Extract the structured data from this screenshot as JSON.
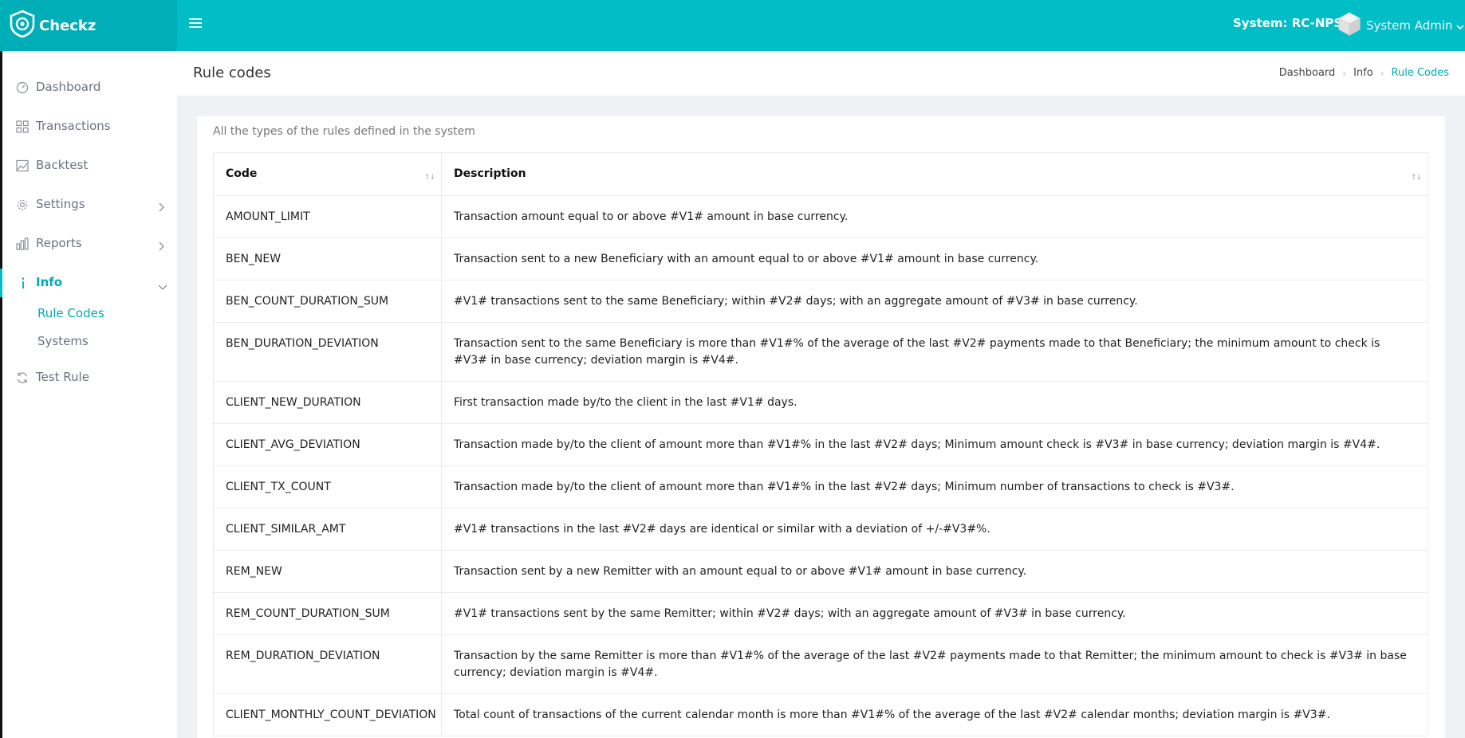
{
  "app": {
    "name": "Checkz",
    "system_label": "System: RC-NPS",
    "user": "System Admin"
  },
  "sidebar": {
    "items": [
      {
        "label": "Dashboard",
        "icon": "dashboard-gauge-icon"
      },
      {
        "label": "Transactions",
        "icon": "grid-icon"
      },
      {
        "label": "Backtest",
        "icon": "image-chart-icon"
      },
      {
        "label": "Settings",
        "icon": "gear-icon"
      },
      {
        "label": "Reports",
        "icon": "bar-chart-icon"
      },
      {
        "label": "Info",
        "icon": "info-icon"
      },
      {
        "label": "Test Rule",
        "icon": "refresh-icon"
      }
    ],
    "info_sub": [
      {
        "label": "Rule Codes"
      },
      {
        "label": "Systems"
      }
    ]
  },
  "page": {
    "title": "Rule codes",
    "breadcrumb": [
      "Dashboard",
      "Info",
      "Rule Codes"
    ],
    "description": "All the types of the rules defined in the system"
  },
  "table": {
    "headers": [
      "Code",
      "Description"
    ],
    "sort_glyph": "↑↓",
    "rows": [
      {
        "code": "AMOUNT_LIMIT",
        "desc": "Transaction amount equal to or above #V1# amount in base currency."
      },
      {
        "code": "BEN_NEW",
        "desc": "Transaction sent to a new Beneficiary with an amount equal to or above #V1# amount in base currency."
      },
      {
        "code": "BEN_COUNT_DURATION_SUM",
        "desc": "#V1# transactions sent to the same Beneficiary; within #V2# days; with an aggregate amount of #V3# in base currency."
      },
      {
        "code": "BEN_DURATION_DEVIATION",
        "desc": "Transaction sent to the same Beneficiary is more than #V1#% of the average of the last #V2# payments made to that Beneficiary; the minimum amount to check is #V3# in base currency; deviation margin is #V4#."
      },
      {
        "code": "CLIENT_NEW_DURATION",
        "desc": "First transaction made by/to the client in the last #V1# days."
      },
      {
        "code": "CLIENT_AVG_DEVIATION",
        "desc": "Transaction made by/to the client of amount more than #V1#% in the last #V2# days; Minimum amount check is #V3# in base currency; deviation margin is #V4#."
      },
      {
        "code": "CLIENT_TX_COUNT",
        "desc": "Transaction made by/to the client of amount more than #V1#% in the last #V2# days; Minimum number of transactions to check is #V3#."
      },
      {
        "code": "CLIENT_SIMILAR_AMT",
        "desc": "#V1# transactions in the last #V2# days are identical or similar with a deviation of +/-#V3#%."
      },
      {
        "code": "REM_NEW",
        "desc": "Transaction sent by a new Remitter with an amount equal to or above #V1# amount in base currency."
      },
      {
        "code": "REM_COUNT_DURATION_SUM",
        "desc": "#V1# transactions sent by the same Remitter; within #V2# days; with an aggregate amount of #V3# in base currency."
      },
      {
        "code": "REM_DURATION_DEVIATION",
        "desc": "Transaction by the same Remitter is more than #V1#% of the average of the last #V2# payments made to that Remitter; the minimum amount to check is #V3# in base currency; deviation margin is #V4#."
      },
      {
        "code": "CLIENT_MONTHLY_COUNT_DEVIATION",
        "desc": "Total count of transactions of the current calendar month is more than #V1#% of the average of the last #V2# calendar months; deviation margin is #V3#."
      }
    ]
  },
  "colors": {
    "topbar": "#00bdc6",
    "brand_bg": "#00aeb7",
    "accent": "#00aab4"
  }
}
